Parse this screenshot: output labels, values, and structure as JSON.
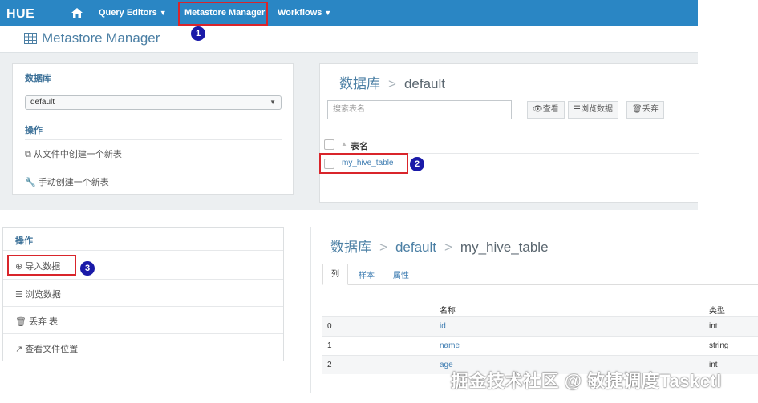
{
  "navbar": {
    "logo": "HUE",
    "items": [
      {
        "label": "Query Editors"
      },
      {
        "label": "Metastore Manager"
      },
      {
        "label": "Workflows"
      }
    ]
  },
  "page_title": "Metastore Manager",
  "badges": [
    "1",
    "2",
    "3"
  ],
  "top_left": {
    "database_heading": "数据库",
    "database_select": "default",
    "actions_heading": "操作",
    "actions": [
      {
        "label": "从文件中创建一个新表",
        "icon": "file-copy-icon"
      },
      {
        "label": "手动创建一个新表",
        "icon": "wrench-icon"
      }
    ]
  },
  "top_right": {
    "breadcrumb": {
      "root": "数据库",
      "sep": ">",
      "current": "default"
    },
    "search_placeholder": "搜索表名",
    "buttons": [
      {
        "label": "查看",
        "icon": "eye-icon"
      },
      {
        "label": "浏览数据",
        "icon": "list-icon"
      },
      {
        "label": "丢弃",
        "icon": "trash-icon"
      }
    ],
    "table_header": "表名",
    "tables": [
      "my_hive_table"
    ]
  },
  "bottom_left": {
    "actions_heading": "操作",
    "actions": [
      {
        "label": "导入数据",
        "icon": "import-icon"
      },
      {
        "label": "浏览数据",
        "icon": "list-icon"
      },
      {
        "label": "丢弃 表",
        "icon": "trash-icon"
      },
      {
        "label": "查看文件位置",
        "icon": "external-link-icon"
      }
    ]
  },
  "bottom_right": {
    "breadcrumb": {
      "root": "数据库",
      "sep": ">",
      "db": "default",
      "table": "my_hive_table"
    },
    "tabs": [
      "列",
      "样本",
      "属性"
    ],
    "columns": {
      "name": "名称",
      "type": "类型"
    },
    "rows": [
      {
        "idx": "0",
        "name": "id",
        "type": "int"
      },
      {
        "idx": "1",
        "name": "name",
        "type": "string"
      },
      {
        "idx": "2",
        "name": "age",
        "type": "int"
      }
    ]
  },
  "watermark": "掘金技术社区 @ 敏捷调度Taskctl",
  "colors": {
    "navbar": "#2a86c4",
    "highlight": "#d9252b",
    "badge": "#1a1aa8",
    "link": "#3f7db2"
  }
}
